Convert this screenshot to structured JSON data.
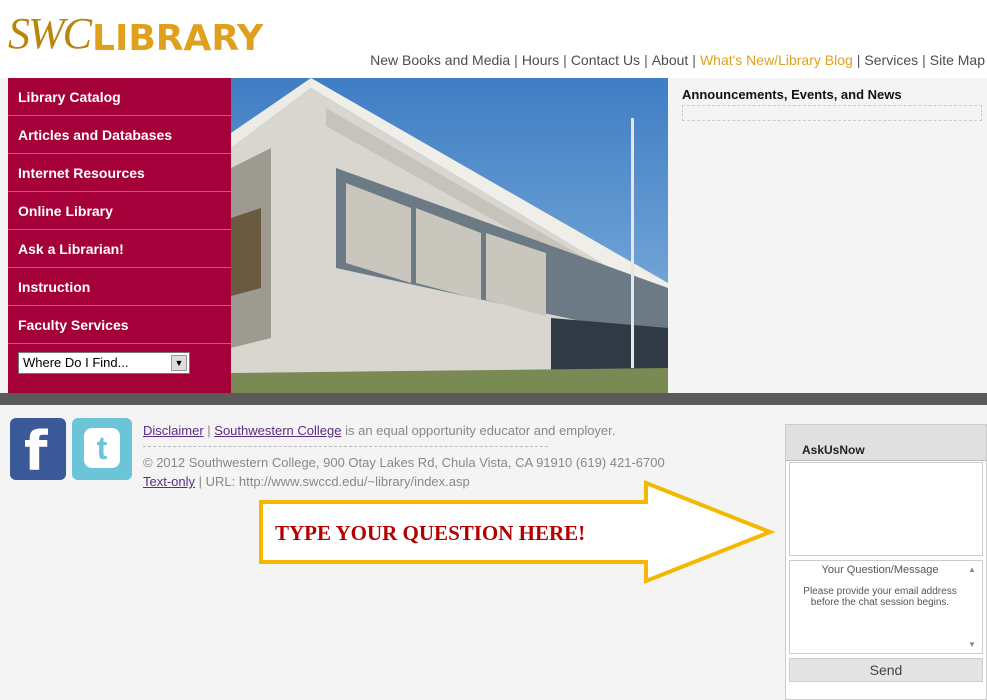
{
  "logo": {
    "swc": "SWC",
    "library": "LIBRARY"
  },
  "topnav": {
    "items": [
      {
        "label": "New Books and Media"
      },
      {
        "label": "Hours"
      },
      {
        "label": "Contact Us"
      },
      {
        "label": "About"
      },
      {
        "label": "What's New/Library Blog"
      },
      {
        "label": "Services"
      },
      {
        "label": "Site Map"
      }
    ],
    "separator": "|",
    "active_color": "#e0a01e"
  },
  "sidenav": {
    "items": [
      {
        "label": "Library Catalog"
      },
      {
        "label": "Articles and Databases"
      },
      {
        "label": "Internet Resources"
      },
      {
        "label": "Online Library"
      },
      {
        "label": "Ask a Librarian!"
      },
      {
        "label": "Instruction"
      },
      {
        "label": "Faculty Services"
      }
    ],
    "select_value": "Where Do I Find...",
    "bg_color": "#a5003a"
  },
  "announcements": {
    "title": "Announcements, Events, and News"
  },
  "footer": {
    "disclaimer": "Disclaimer",
    "sep1": " | ",
    "college": "Southwestern College",
    "equal_opportunity": " is an equal opportunity educator and employer.",
    "address": "© 2012 Southwestern College, 900 Otay Lakes Rd, Chula Vista, CA 91910 (619) 421-6700",
    "text_only": "Text-only",
    "url_text": " | URL: http://www.swccd.edu/~library/index.asp"
  },
  "social": {
    "facebook": "f",
    "twitter": "t"
  },
  "callout": {
    "text": "TYPE YOUR QUESTION HERE!",
    "arrow_color": "#f5b800",
    "text_color": "#b30000"
  },
  "chat": {
    "title": "AskUsNow",
    "input_placeholder": "Your Question/Message",
    "hint": "Please provide your email address before the chat session begins.",
    "send_label": "Send"
  }
}
